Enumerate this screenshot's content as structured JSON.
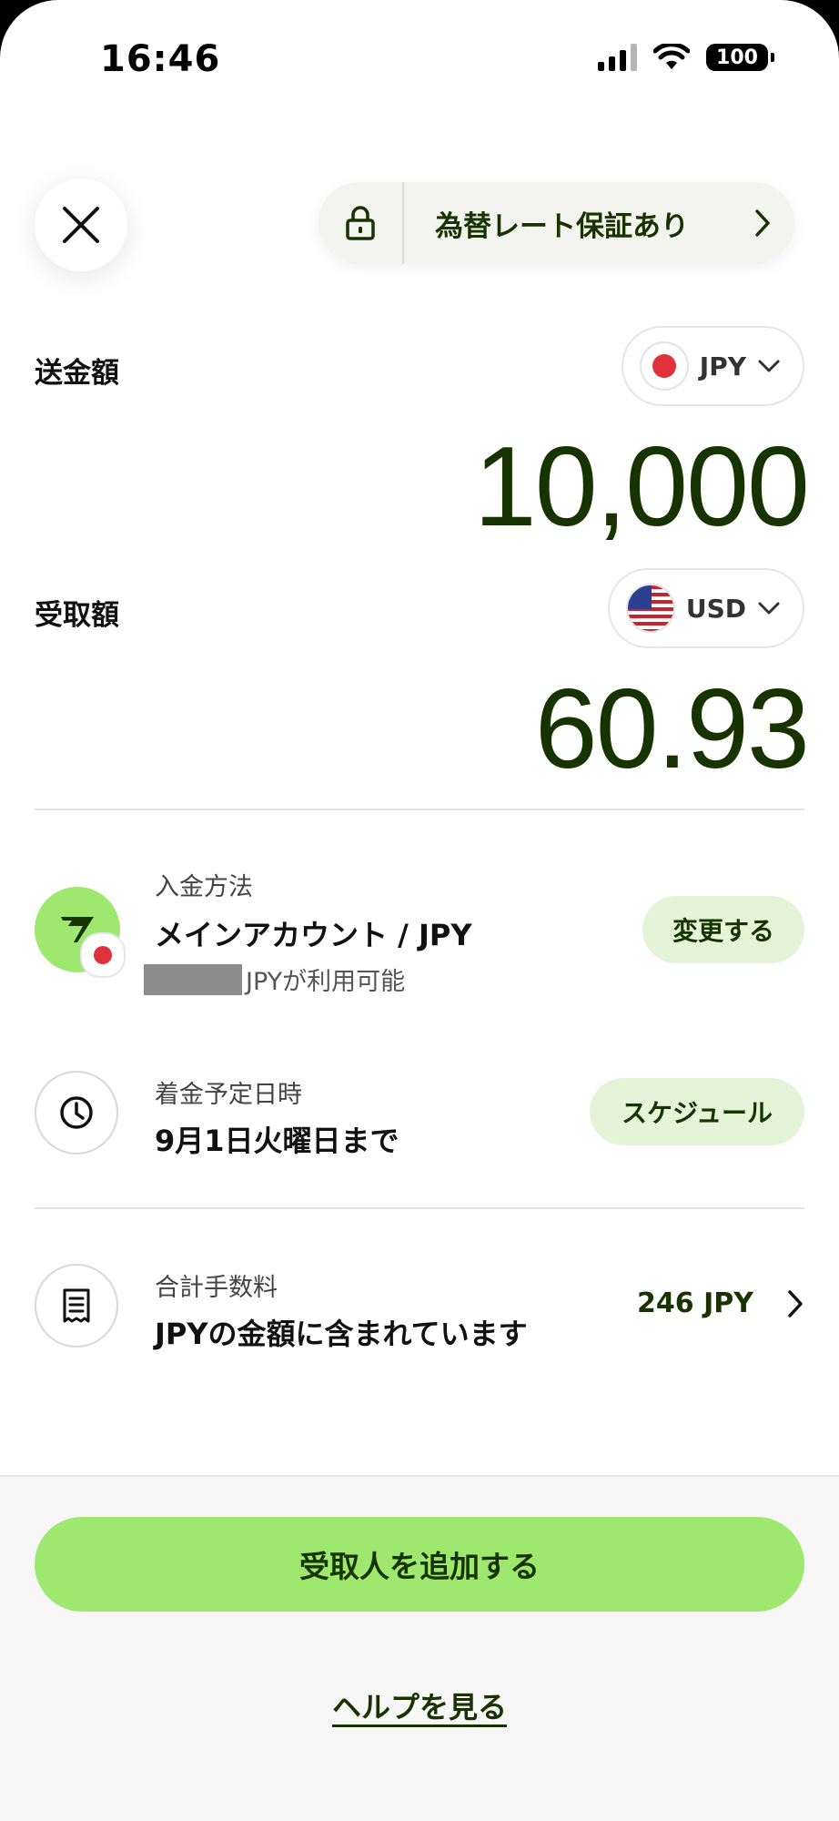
{
  "status_bar": {
    "time": "16:46",
    "battery": "100"
  },
  "header": {
    "close_icon": "close-icon",
    "rate_guarantee_label": "為替レート保証あり"
  },
  "send": {
    "label": "送金額",
    "currency": "JPY",
    "amount": "10,000"
  },
  "receive": {
    "label": "受取額",
    "currency": "USD",
    "amount": "60.93"
  },
  "payment_method": {
    "title": "入金方法",
    "value": "メインアカウント / JPY",
    "available_note": "JPYが利用可能",
    "button": "変更する"
  },
  "arrival": {
    "title": "着金予定日時",
    "value": "9月1日火曜日まで",
    "button": "スケジュール"
  },
  "fees": {
    "title": "合計手数料",
    "value": "JPYの金額に含まれています",
    "amount": "246 JPY"
  },
  "footer": {
    "primary_button": "受取人を追加する",
    "help_link": "ヘルプを見る"
  },
  "colors": {
    "brand_green": "#9fe870",
    "dark_green": "#163300",
    "light_green": "#e3f4d8"
  }
}
